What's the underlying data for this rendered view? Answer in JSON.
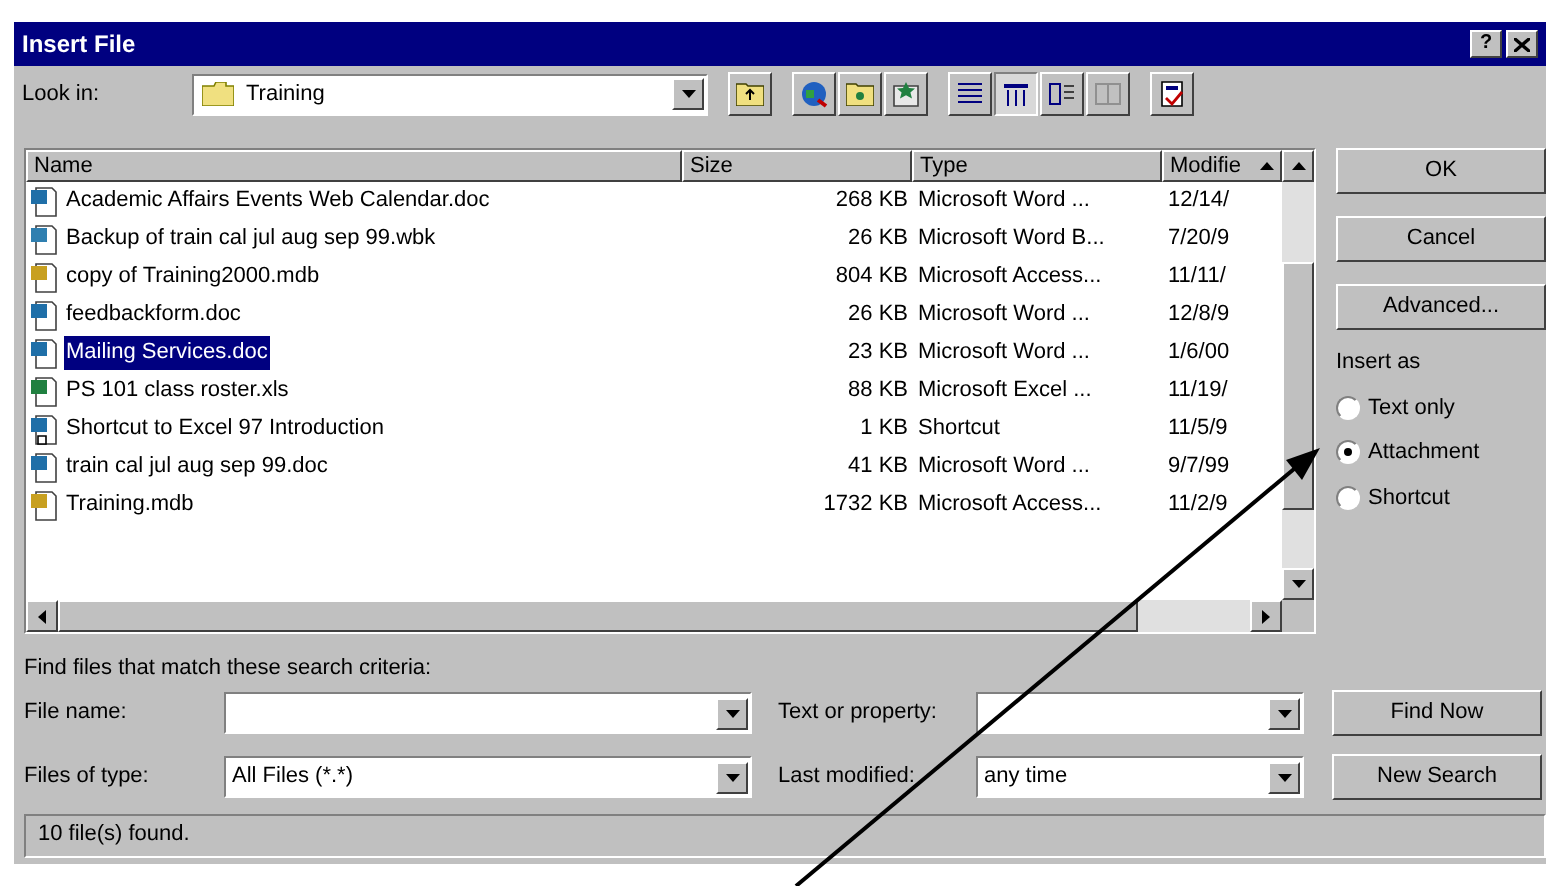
{
  "window": {
    "title": "Insert File",
    "help_button": "?"
  },
  "look_in": {
    "label": "Look in:",
    "value": "Training"
  },
  "file_list": {
    "columns": [
      "Name",
      "Size",
      "Type",
      "Modifie"
    ],
    "rows": [
      {
        "kind": "word",
        "name": "Academic Affairs Events Web Calendar.doc",
        "size": "268 KB",
        "type": "Microsoft Word ...",
        "modified": "12/14/",
        "selected": false
      },
      {
        "kind": "backup",
        "name": "Backup of train cal jul aug sep 99.wbk",
        "size": "26 KB",
        "type": "Microsoft Word B...",
        "modified": "7/20/9",
        "selected": false
      },
      {
        "kind": "access",
        "name": "copy of Training2000.mdb",
        "size": "804 KB",
        "type": "Microsoft Access...",
        "modified": "11/11/",
        "selected": false
      },
      {
        "kind": "word",
        "name": "feedbackform.doc",
        "size": "26 KB",
        "type": "Microsoft Word ...",
        "modified": "12/8/9",
        "selected": false
      },
      {
        "kind": "word",
        "name": "Mailing Services.doc",
        "size": "23 KB",
        "type": "Microsoft Word ...",
        "modified": "1/6/00",
        "selected": true
      },
      {
        "kind": "excel",
        "name": "PS 101 class roster.xls",
        "size": "88 KB",
        "type": "Microsoft Excel ...",
        "modified": "11/19/",
        "selected": false
      },
      {
        "kind": "shortcut",
        "name": "Shortcut to Excel 97 Introduction",
        "size": "1 KB",
        "type": "Shortcut",
        "modified": "11/5/9",
        "selected": false
      },
      {
        "kind": "word",
        "name": "train cal jul aug sep 99.doc",
        "size": "41 KB",
        "type": "Microsoft Word ...",
        "modified": "9/7/99",
        "selected": false
      },
      {
        "kind": "access",
        "name": "Training.mdb",
        "size": "1732 KB",
        "type": "Microsoft Access...",
        "modified": "11/2/9",
        "selected": false
      }
    ]
  },
  "buttons": [
    "OK",
    "Cancel",
    "Advanced..."
  ],
  "insert_as": {
    "label": "Insert as",
    "options": [
      {
        "label": "Text only",
        "selected": false
      },
      {
        "label": "Attachment",
        "selected": true
      },
      {
        "label": "Shortcut",
        "selected": false
      }
    ]
  },
  "search": {
    "heading": "Find files that match these search criteria:",
    "file_name": {
      "label": "File name:"
    },
    "text_or_property": {
      "label": "Text or property:"
    },
    "files_of_type": {
      "label": "Files of type:",
      "value": "All Files (*.*)"
    },
    "last_modified": {
      "label": "Last modified:",
      "value": "any time"
    },
    "buttons": [
      "Find Now",
      "New Search"
    ]
  },
  "status_bar": "10 file(s) found."
}
